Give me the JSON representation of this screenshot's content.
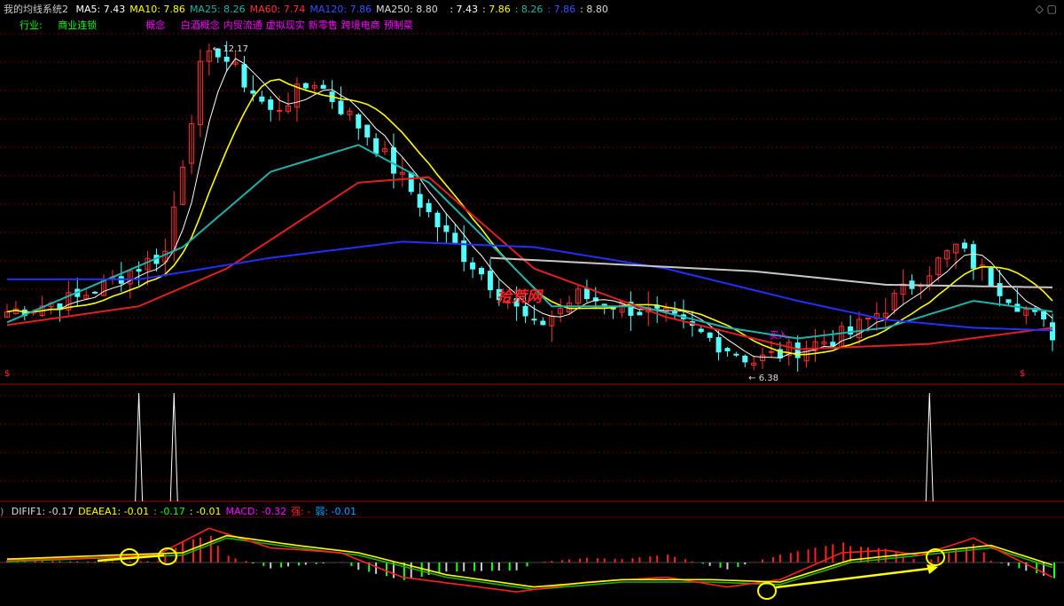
{
  "header": {
    "system_name": "我的均线系统2",
    "ma_items": [
      {
        "label": "MA5",
        "value": "7.43",
        "color": "#ffffff"
      },
      {
        "label": "MA10",
        "value": "7.86",
        "color": "#ffff00"
      },
      {
        "label": "MA25",
        "value": "8.26",
        "color": "#20b2aa"
      },
      {
        "label": "MA60",
        "value": "7.74",
        "color": "#ff3030"
      },
      {
        "label": "MA120",
        "value": "7.86",
        "color": "#3050ff"
      },
      {
        "label": "MA250",
        "value": "8.80",
        "color": "#dddddd"
      }
    ],
    "extra_values": [
      {
        "value": "7.43",
        "color": "#ffffff"
      },
      {
        "value": "7.86",
        "color": "#ffff00"
      },
      {
        "value": "8.26",
        "color": "#20b2aa"
      },
      {
        "value": "7.86",
        "color": "#3050ff"
      },
      {
        "value": "8.80",
        "color": "#dddddd"
      }
    ]
  },
  "industry": {
    "label": "行业:",
    "value": "商业连锁",
    "concept_label": "概念",
    "concepts": [
      "白酒概念",
      "内贸流通",
      "虚拟现实",
      "新零售",
      "跨境电商",
      "预制菜"
    ]
  },
  "watermark": "拾荒网",
  "annotations": {
    "high_label": "12.17",
    "low_label": "6.38",
    "buy_label": "买入",
    "marker_left": "$",
    "marker_right": "$"
  },
  "macd_legend": {
    "items": [
      {
        "label": "DIFIF1",
        "value": "-0.17",
        "color": "#dddddd"
      },
      {
        "label": "DEAEA1",
        "value": "-0.01",
        "color": "#ffff00"
      },
      {
        "label": "",
        "value": "-0.17",
        "color": "#00ff00"
      },
      {
        "label": "",
        "value": "-0.01",
        "color": "#ffff00"
      },
      {
        "label": "MACD",
        "value": "-0.32",
        "color": "#ff00ff"
      },
      {
        "label": "强",
        "value": "-",
        "color": "#ff2020"
      },
      {
        "label": "弱",
        "value": "-0.01",
        "color": "#00a0ff"
      }
    ]
  },
  "colors": {
    "up": "#ff3030",
    "down": "#54ffff",
    "grid": "#8b0000",
    "concept": "#ff00ff",
    "industry": "#00ff00",
    "watermark": "#ff2020"
  },
  "chart_data": [
    {
      "type": "candlestick",
      "title": "",
      "ylim": [
        6.0,
        12.6
      ],
      "n_bars": 120,
      "key_points": [
        {
          "bar": 0,
          "price": 7.3
        },
        {
          "bar": 8,
          "price": 7.55
        },
        {
          "bar": 18,
          "price": 8.4
        },
        {
          "bar": 22,
          "price": 11.8
        },
        {
          "bar": 24,
          "price": 12.17
        },
        {
          "bar": 30,
          "price": 11.0
        },
        {
          "bar": 35,
          "price": 11.6
        },
        {
          "bar": 41,
          "price": 10.6
        },
        {
          "bar": 50,
          "price": 8.7
        },
        {
          "bar": 60,
          "price": 7.0
        },
        {
          "bar": 65,
          "price": 7.6
        },
        {
          "bar": 75,
          "price": 7.2
        },
        {
          "bar": 80,
          "price": 6.8
        },
        {
          "bar": 85,
          "price": 6.38
        },
        {
          "bar": 96,
          "price": 6.9
        },
        {
          "bar": 100,
          "price": 7.4
        },
        {
          "bar": 108,
          "price": 8.5
        },
        {
          "bar": 112,
          "price": 7.9
        },
        {
          "bar": 119,
          "price": 6.9
        }
      ],
      "ma_lines": [
        {
          "name": "MA25",
          "points": [
            [
              0,
              7.1
            ],
            [
              20,
              8.5
            ],
            [
              30,
              9.9
            ],
            [
              40,
              10.4
            ],
            [
              48,
              9.7
            ],
            [
              56,
              8.4
            ],
            [
              62,
              7.4
            ],
            [
              72,
              7.4
            ],
            [
              82,
              7.0
            ],
            [
              90,
              6.8
            ],
            [
              100,
              7.0
            ],
            [
              110,
              7.5
            ],
            [
              119,
              7.3
            ]
          ]
        },
        {
          "name": "MA60",
          "points": [
            [
              0,
              7.05
            ],
            [
              15,
              7.4
            ],
            [
              25,
              8.1
            ],
            [
              40,
              9.7
            ],
            [
              48,
              9.8
            ],
            [
              60,
              8.1
            ],
            [
              75,
              7.2
            ],
            [
              90,
              6.6
            ],
            [
              105,
              6.7
            ],
            [
              119,
              7.0
            ]
          ]
        },
        {
          "name": "MA120",
          "points": [
            [
              0,
              7.9
            ],
            [
              15,
              7.9
            ],
            [
              30,
              8.3
            ],
            [
              45,
              8.6
            ],
            [
              60,
              8.5
            ],
            [
              75,
              8.1
            ],
            [
              90,
              7.5
            ],
            [
              100,
              7.15
            ],
            [
              110,
              7.0
            ],
            [
              119,
              6.95
            ]
          ]
        },
        {
          "name": "MA250",
          "points": [
            [
              55,
              8.3
            ],
            [
              85,
              8.05
            ],
            [
              100,
              7.8
            ],
            [
              119,
              7.75
            ]
          ]
        }
      ]
    },
    {
      "type": "line",
      "title": "",
      "spikes_at_bars": [
        15,
        19,
        105
      ],
      "ylim": [
        0,
        1
      ]
    },
    {
      "type": "bar",
      "title": "MACD",
      "ylim": [
        -0.8,
        0.8
      ],
      "dif": [
        [
          0,
          0.05
        ],
        [
          10,
          0.1
        ],
        [
          17,
          0.15
        ],
        [
          23,
          0.7
        ],
        [
          30,
          0.3
        ],
        [
          38,
          0.2
        ],
        [
          45,
          -0.3
        ],
        [
          58,
          -0.6
        ],
        [
          66,
          -0.4
        ],
        [
          75,
          -0.3
        ],
        [
          82,
          -0.5
        ],
        [
          88,
          -0.35
        ],
        [
          95,
          0.2
        ],
        [
          100,
          0.25
        ],
        [
          104,
          0.15
        ],
        [
          110,
          0.5
        ],
        [
          119,
          -0.3
        ]
      ],
      "dea": [
        [
          0,
          0.02
        ],
        [
          12,
          0.1
        ],
        [
          20,
          0.15
        ],
        [
          25,
          0.5
        ],
        [
          33,
          0.3
        ],
        [
          40,
          0.15
        ],
        [
          50,
          -0.3
        ],
        [
          60,
          -0.55
        ],
        [
          70,
          -0.4
        ],
        [
          80,
          -0.4
        ],
        [
          88,
          -0.45
        ],
        [
          96,
          0.0
        ],
        [
          104,
          0.15
        ],
        [
          112,
          0.3
        ],
        [
          119,
          -0.1
        ]
      ]
    }
  ]
}
